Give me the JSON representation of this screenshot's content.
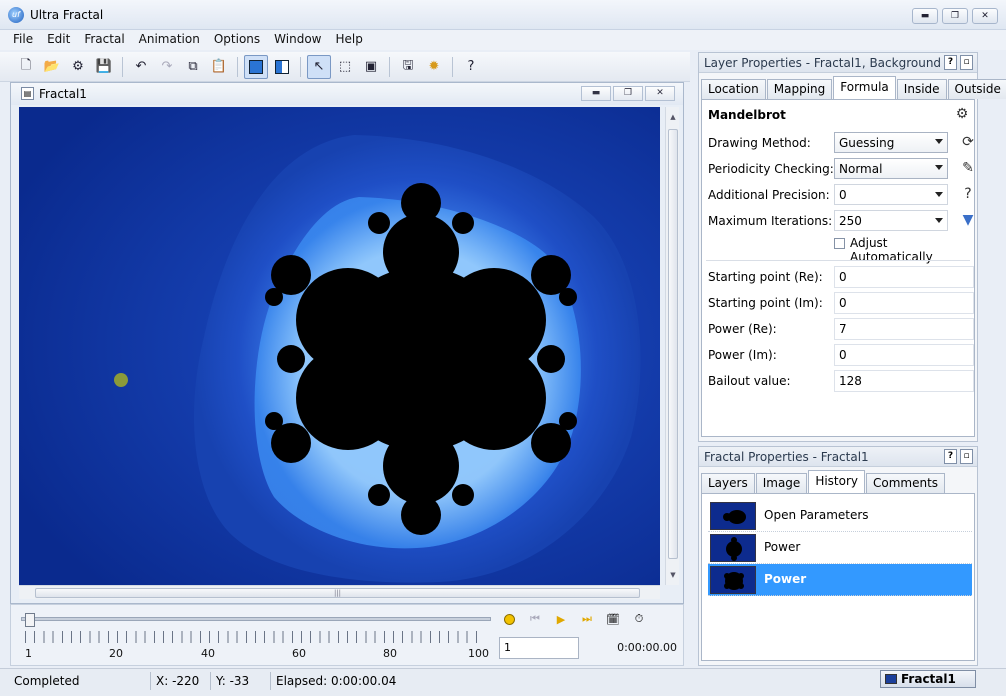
{
  "app": {
    "title": "Ultra Fractal",
    "icon": "uf-logo-icon"
  },
  "menu": [
    "File",
    "Edit",
    "Fractal",
    "Animation",
    "Options",
    "Window",
    "Help"
  ],
  "toolbar": {
    "icons": [
      "new-file-icon",
      "open-folder-icon",
      "open-parameters-icon",
      "save-icon",
      "undo-icon",
      "redo-icon",
      "copy-icon",
      "paste-icon",
      "fullscreen-icon",
      "split-view-icon",
      "select-arrow-icon",
      "select-box-icon",
      "zoom-window-icon",
      "render-icon",
      "gear-icon",
      "help-icon"
    ]
  },
  "document": {
    "title": "Fractal1",
    "canvas_colors": {
      "background": "#0d2f9a",
      "halo": "#1f4fc6",
      "set": "#000000"
    }
  },
  "timeline": {
    "tick_labels": [
      "1",
      "20",
      "40",
      "60",
      "80",
      "100"
    ],
    "frame_value": "1",
    "time": "0:00:00.00"
  },
  "status": {
    "state": "Completed",
    "x": "X: -220",
    "y": "Y: -33",
    "elapsed": "Elapsed: 0:00:00.04",
    "task": "Fractal1"
  },
  "layer_panel": {
    "title": "Layer Properties - Fractal1, Background",
    "tabs": [
      "Location",
      "Mapping",
      "Formula",
      "Inside",
      "Outside"
    ],
    "active_tab": "Formula",
    "formula_name": "Mandelbrot",
    "drawing_method_label": "Drawing Method:",
    "drawing_method_value": "Guessing",
    "periodicity_label": "Periodicity Checking:",
    "periodicity_value": "Normal",
    "precision_label": "Additional Precision:",
    "precision_value": "0",
    "max_iter_label": "Maximum Iterations:",
    "max_iter_value": "250",
    "adjust_label": "Adjust Automatically",
    "params": [
      {
        "label": "Starting point (Re):",
        "value": "0"
      },
      {
        "label": "Starting point (Im):",
        "value": "0"
      },
      {
        "label": "Power (Re):",
        "value": "7"
      },
      {
        "label": "Power (Im):",
        "value": "0"
      },
      {
        "label": "Bailout value:",
        "value": "128"
      }
    ]
  },
  "fractal_panel": {
    "title": "Fractal Properties - Fractal1",
    "tabs": [
      "Layers",
      "Image",
      "History",
      "Comments"
    ],
    "active_tab": "History",
    "history": [
      "Open Parameters",
      "Power",
      "Power"
    ]
  },
  "colors": {
    "selection": "#3399ff",
    "fractal_blue": "#0d2f9a"
  }
}
